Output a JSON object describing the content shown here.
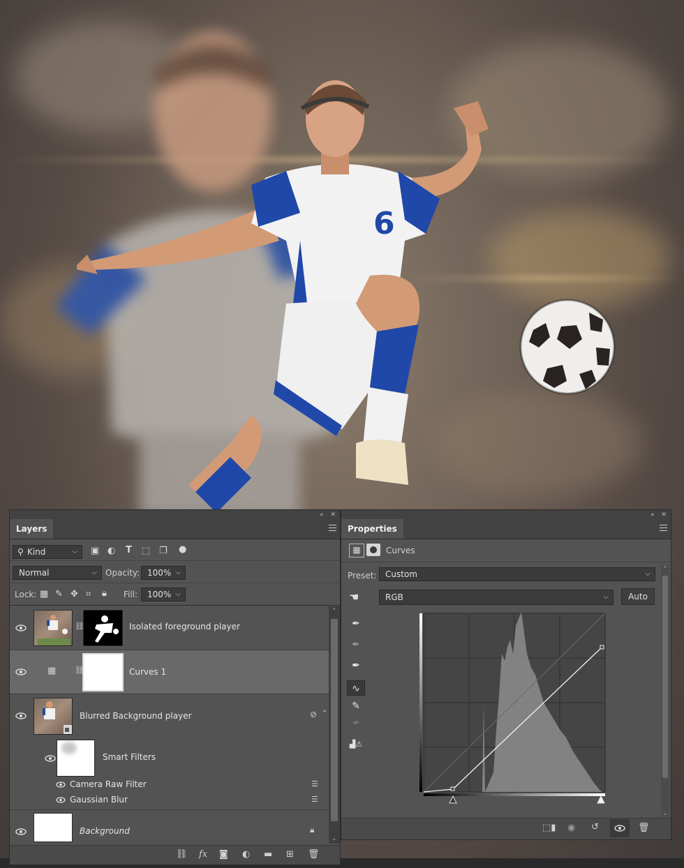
{
  "layers_panel": {
    "tab": "Layers",
    "kind_filter": "Kind",
    "blend_mode": "Normal",
    "opacity_label": "Opacity:",
    "opacity_value": "100%",
    "lock_label": "Lock:",
    "fill_label": "Fill:",
    "fill_value": "100%",
    "layers": [
      {
        "name": "Isolated foreground player",
        "visible": true
      },
      {
        "name": "Curves 1",
        "visible": true,
        "selected": true
      },
      {
        "name": "Blurred Background player",
        "visible": true
      },
      {
        "name": "Smart Filters",
        "visible": true
      },
      {
        "name": "Camera Raw Filter",
        "visible": true
      },
      {
        "name": "Gaussian Blur",
        "visible": true
      },
      {
        "name": "Background",
        "visible": true,
        "locked": true
      }
    ]
  },
  "properties_panel": {
    "tab": "Properties",
    "adjustment": "Curves",
    "preset_label": "Preset:",
    "preset_value": "Custom",
    "channel": "RGB",
    "auto_label": "Auto"
  },
  "colors": {
    "panel_bg": "#535353",
    "panel_dark": "#424242",
    "selected_row": "#696969",
    "jersey_blue": "#1f48a8"
  }
}
